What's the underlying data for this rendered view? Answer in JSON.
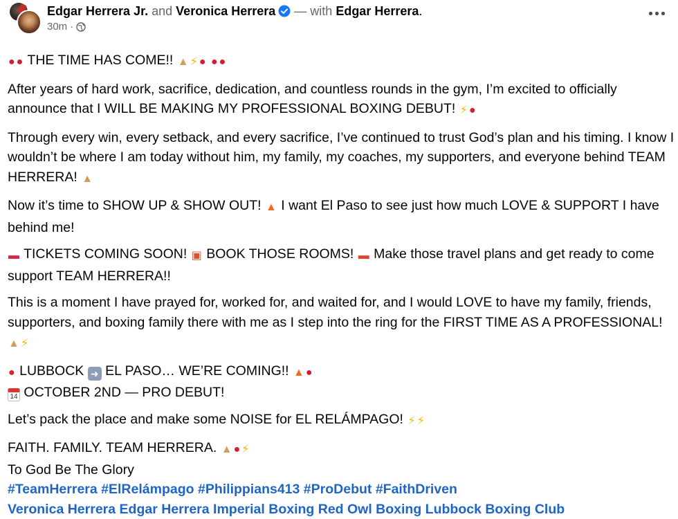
{
  "post": {
    "author_primary": "Edgar Herrera Jr.",
    "conjunction": "and",
    "author_secondary": "Veronica Herrera",
    "with_text": "— with",
    "tagged_person": "Edgar Herrera",
    "tagged_suffix": ".",
    "timestamp": "30m",
    "separator": "·",
    "privacy_icon": "globe-icon",
    "more_icon": "more-options-icon"
  },
  "content": {
    "p1": "THE TIME HAS COME!!",
    "p2": "After years of hard work, sacrifice, dedication, and countless rounds in the gym, I’m excited to officially announce that I WILL BE MAKING MY PROFESSIONAL BOXING DEBUT!",
    "p3": "Through every win, every setback, and every sacrifice, I’ve continued to trust God’s plan and his timing. I know I wouldn’t be where I am today without him, my family, my coaches, my supporters, and everyone behind TEAM HERRERA!",
    "p4a": "Now it’s time to SHOW UP & SHOW OUT!",
    "p4b": "I want El Paso to see just how much LOVE & SUPPORT I have behind me!",
    "p5a": "TICKETS COMING SOON!",
    "p5b": "BOOK THOSE ROOMS!",
    "p5c": "Make those travel plans and get ready to come support TEAM HERRERA!!",
    "p6": "This is a moment I have prayed for, worked for, and waited for, and I would LOVE to have my family, friends, supporters, and boxing family there with me as I step into the ring for the FIRST TIME AS A PROFESSIONAL!",
    "p7a": "LUBBOCK",
    "p7b": "EL PASO… WE’RE COMING!!",
    "p8": "OCTOBER 2ND — PRO DEBUT!",
    "cal_day": "14",
    "p9": "Let’s pack the place and make some NOISE for EL RELÁMPAGO!",
    "p10": "FAITH. FAMILY. TEAM HERRERA.",
    "p11": "To God Be The Glory",
    "hashtags": [
      "#TeamHerrera",
      "#ElRelámpago",
      "#Philippians413",
      "#ProDebut",
      "#FaithDriven"
    ],
    "mentions": [
      "Veronica Herrera",
      "Edgar Herrera",
      "Imperial Boxing",
      "Red Owl Boxing",
      "Lubbock Boxing Club"
    ]
  },
  "colors": {
    "link_blue": "#1f65c7",
    "verified_blue": "#1877f2",
    "muted_text": "#65676b"
  }
}
